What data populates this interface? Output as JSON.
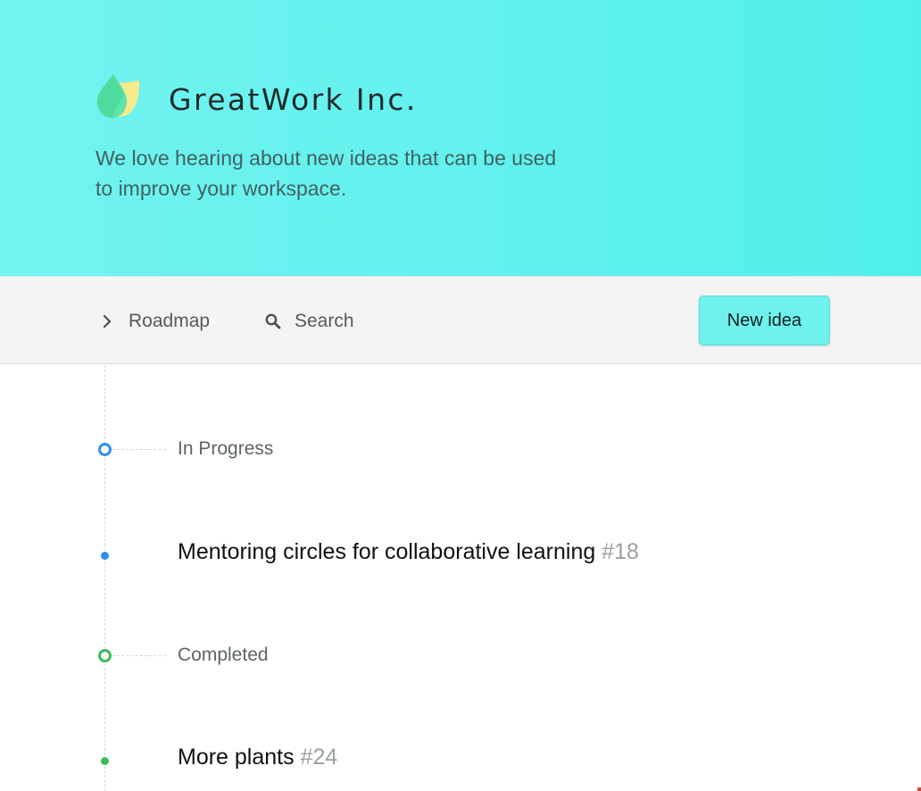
{
  "header": {
    "brand": "GreatWork Inc.",
    "tagline": "We love hearing about new ideas that can be used to improve your workspace.",
    "logo_icon": "leaf-drop-logo"
  },
  "nav": {
    "roadmap_label": "Roadmap",
    "roadmap_icon": "chevron-right-icon",
    "search_label": "Search",
    "search_icon": "search-icon",
    "new_idea_label": "New idea"
  },
  "timeline": {
    "groups": [
      {
        "status": "In Progress",
        "color": "#2f8fef",
        "ideas": [
          {
            "title": "Mentoring circles for collaborative learning",
            "number": "#18"
          }
        ]
      },
      {
        "status": "Completed",
        "color": "#3dbb5c",
        "ideas": [
          {
            "title": "More plants",
            "number": "#24"
          }
        ]
      }
    ]
  },
  "colors": {
    "header_bg": "#63f1ee",
    "button_bg": "#6ff1ee",
    "in_progress": "#2f8fef",
    "completed": "#3dbb5c"
  }
}
